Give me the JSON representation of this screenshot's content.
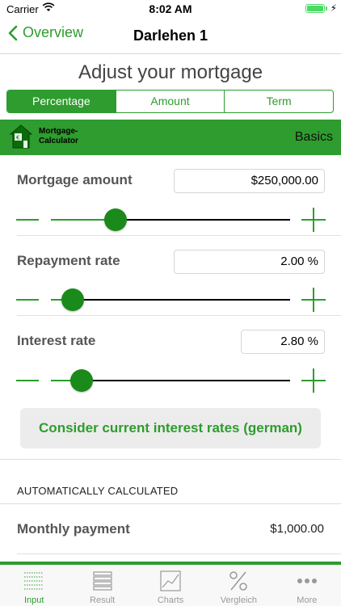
{
  "status": {
    "carrier": "Carrier",
    "time": "8:02 AM"
  },
  "nav": {
    "back_label": "Overview",
    "title": "Darlehen 1"
  },
  "heading": "Adjust your mortgage",
  "segments": [
    {
      "label": "Percentage",
      "active": true
    },
    {
      "label": "Amount",
      "active": false
    },
    {
      "label": "Term",
      "active": false
    }
  ],
  "banner": {
    "logo_line1": "Mortgage-",
    "logo_line2": "Calculator",
    "section": "Basics"
  },
  "fields": {
    "mortgage_amount": {
      "label": "Mortgage amount",
      "value": "$250,000.00",
      "slider_level": 0.27
    },
    "repayment_rate": {
      "label": "Repayment rate",
      "value": "2.00 %",
      "slider_level": 0.09
    },
    "interest_rate": {
      "label": "Interest rate",
      "value": "2.80 %",
      "slider_level": 0.13
    }
  },
  "rates_button": "Consider current interest rates (german)",
  "auto_header": "AUTOMATICALLY CALCULATED",
  "monthly": {
    "label": "Monthly payment",
    "value": "$1,000.00"
  },
  "tabs": [
    {
      "label": "Input",
      "icon": "input-icon",
      "active": true
    },
    {
      "label": "Result",
      "icon": "result-icon",
      "active": false
    },
    {
      "label": "Charts",
      "icon": "charts-icon",
      "active": false
    },
    {
      "label": "Vergleich",
      "icon": "percent-icon",
      "active": false
    },
    {
      "label": "More",
      "icon": "more-icon",
      "active": false
    }
  ],
  "colors": {
    "accent": "#2e9c2e",
    "thumb": "#1a8a1a"
  }
}
